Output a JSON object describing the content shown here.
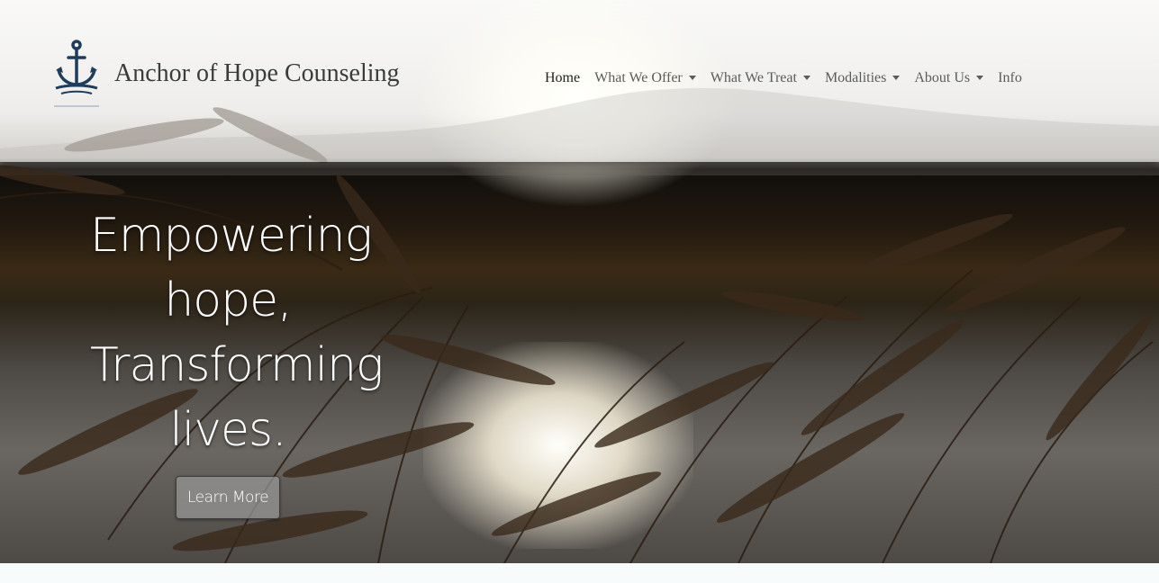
{
  "brand": {
    "name": "Anchor of Hope Counseling",
    "logo_icon": "anchor-icon"
  },
  "nav": {
    "items": [
      {
        "label": "Home",
        "active": true,
        "dropdown": false
      },
      {
        "label": "What We Offer",
        "active": false,
        "dropdown": true
      },
      {
        "label": "What We Treat",
        "active": false,
        "dropdown": true
      },
      {
        "label": "Modalities",
        "active": false,
        "dropdown": true
      },
      {
        "label": "About Us",
        "active": false,
        "dropdown": true
      },
      {
        "label": "Info",
        "active": false,
        "dropdown": false
      }
    ]
  },
  "hero": {
    "lines": [
      "Empowering",
      "hope,",
      "Transforming",
      "lives."
    ],
    "button_label": "Learn More"
  },
  "colors": {
    "logo": "#1e3d5c",
    "nav_text": "#5b5b5b",
    "nav_active": "#222222",
    "hero_text": "#ffffff"
  }
}
